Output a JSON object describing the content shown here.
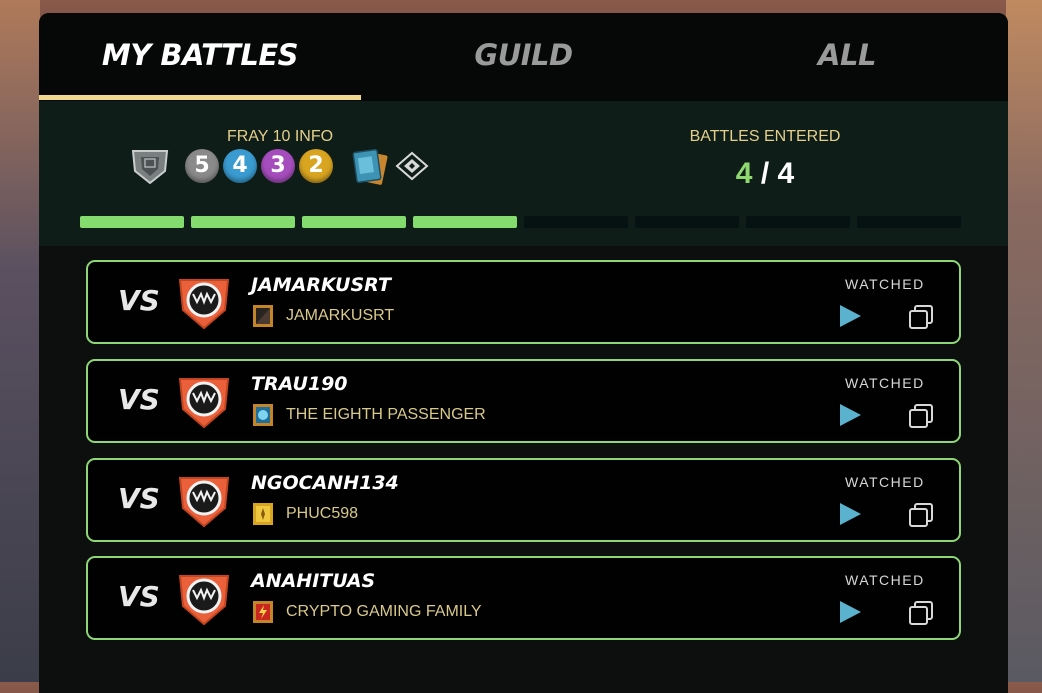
{
  "tabs": [
    {
      "label": "MY BATTLES",
      "active": true
    },
    {
      "label": "GUILD",
      "active": false
    },
    {
      "label": "ALL",
      "active": false
    }
  ],
  "info": {
    "fray_title": "FRAY 10 INFO",
    "rating_circles": [
      "5",
      "4",
      "3",
      "2"
    ],
    "battles_entered_title": "BATTLES ENTERED",
    "battles_entered": "4",
    "battles_total": "4",
    "progress_segments_filled": 4,
    "progress_segments_total": 8
  },
  "battles": [
    {
      "vs": "VS",
      "player": "JAMARKUSRT",
      "guild": "JAMARKUSRT",
      "guild_icon": "dark-banner-icon",
      "status": "WATCHED"
    },
    {
      "vs": "VS",
      "player": "TRAU190",
      "guild": "THE EIGHTH PASSENGER",
      "guild_icon": "blue-orb-banner-icon",
      "status": "WATCHED"
    },
    {
      "vs": "VS",
      "player": "NGOCANH134",
      "guild": "PHUC598",
      "guild_icon": "gold-banner-icon",
      "status": "WATCHED"
    },
    {
      "vs": "VS",
      "player": "ANAHITUAS",
      "guild": "CRYPTO GAMING FAMILY",
      "guild_icon": "lightning-banner-icon",
      "status": "WATCHED"
    }
  ],
  "colors": {
    "accent_green": "#84dc6e",
    "tab_underline": "#f0d98c",
    "gold_text": "#e3cf8a",
    "play_blue": "#5ab2cf"
  }
}
